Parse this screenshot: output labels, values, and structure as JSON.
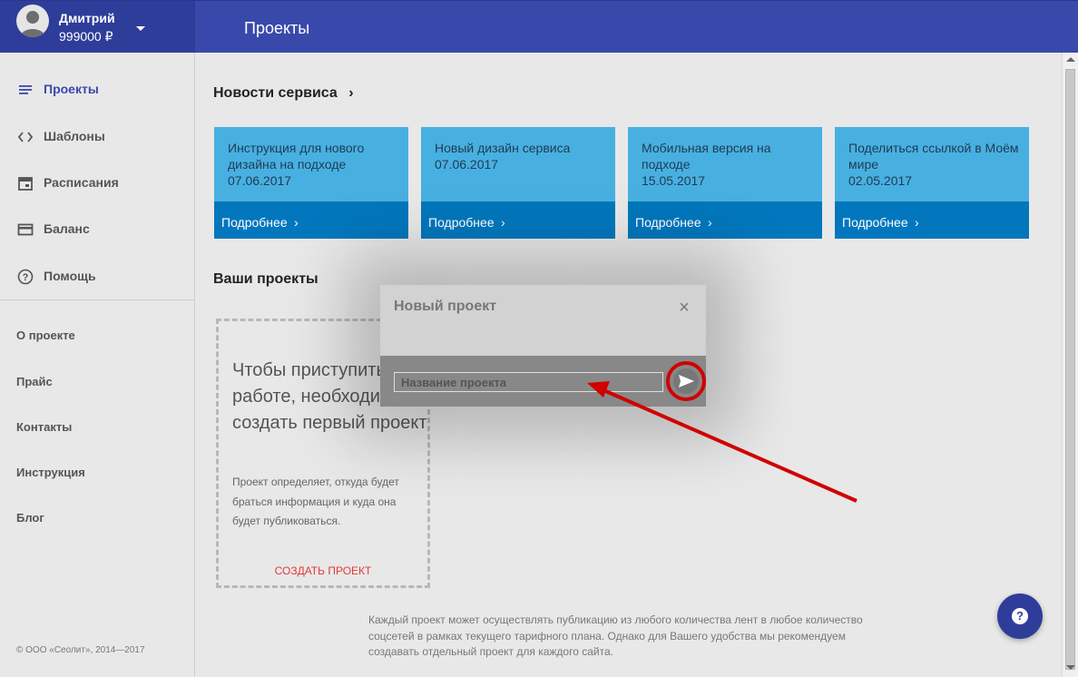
{
  "user": {
    "name": "Дмитрий",
    "balance": "999000 ₽"
  },
  "header": {
    "title": "Проекты"
  },
  "sidebar": {
    "nav": [
      {
        "label": "Проекты",
        "icon": "list-icon"
      },
      {
        "label": "Шаблоны",
        "icon": "code-icon"
      },
      {
        "label": "Расписания",
        "icon": "calendar-icon"
      },
      {
        "label": "Баланс",
        "icon": "card-icon"
      },
      {
        "label": "Помощь",
        "icon": "help-circle-icon"
      }
    ],
    "links": [
      "О проекте",
      "Прайс",
      "Контакты",
      "Инструкция",
      "Блог"
    ],
    "copyright": "© ООО «Сеолит», 2014—2017"
  },
  "news": {
    "title": "Новости сервиса",
    "cards": [
      {
        "text": "Инструкция для нового дизайна на подходе",
        "date": "07.06.2017",
        "more": "Подробнее"
      },
      {
        "text": "Новый дизайн сервиса",
        "date": "07.06.2017",
        "more": "Подробнее"
      },
      {
        "text": "Мобильная версия на подходе",
        "date": "15.05.2017",
        "more": "Подробнее"
      },
      {
        "text": "Поделиться ссылкой в Моём мире",
        "date": "02.05.2017",
        "more": "Подробнее"
      }
    ]
  },
  "projects": {
    "title": "Ваши проекты",
    "empty_big": "Чтобы приступить к работе, необходимо создать первый проект",
    "empty_small": "Проект определяет, откуда будет браться информация и куда она будет публиковаться.",
    "create": "СОЗДАТЬ ПРОЕКТ"
  },
  "footer_note": "Каждый проект может осуществлять публикацию из любого количества лент в любое количество соцсетей в рамках текущего тарифного плана. Однако для Вашего удобства мы рекомендуем создавать отдельный проект для каждого сайта.",
  "modal": {
    "title": "Новый проект",
    "input_placeholder": "Название проекта"
  },
  "colors": {
    "header": "#3949ab",
    "card": "#48b0e0",
    "card_footer": "#0277bd",
    "annotation": "#d00000",
    "create_link": "#e53935"
  }
}
